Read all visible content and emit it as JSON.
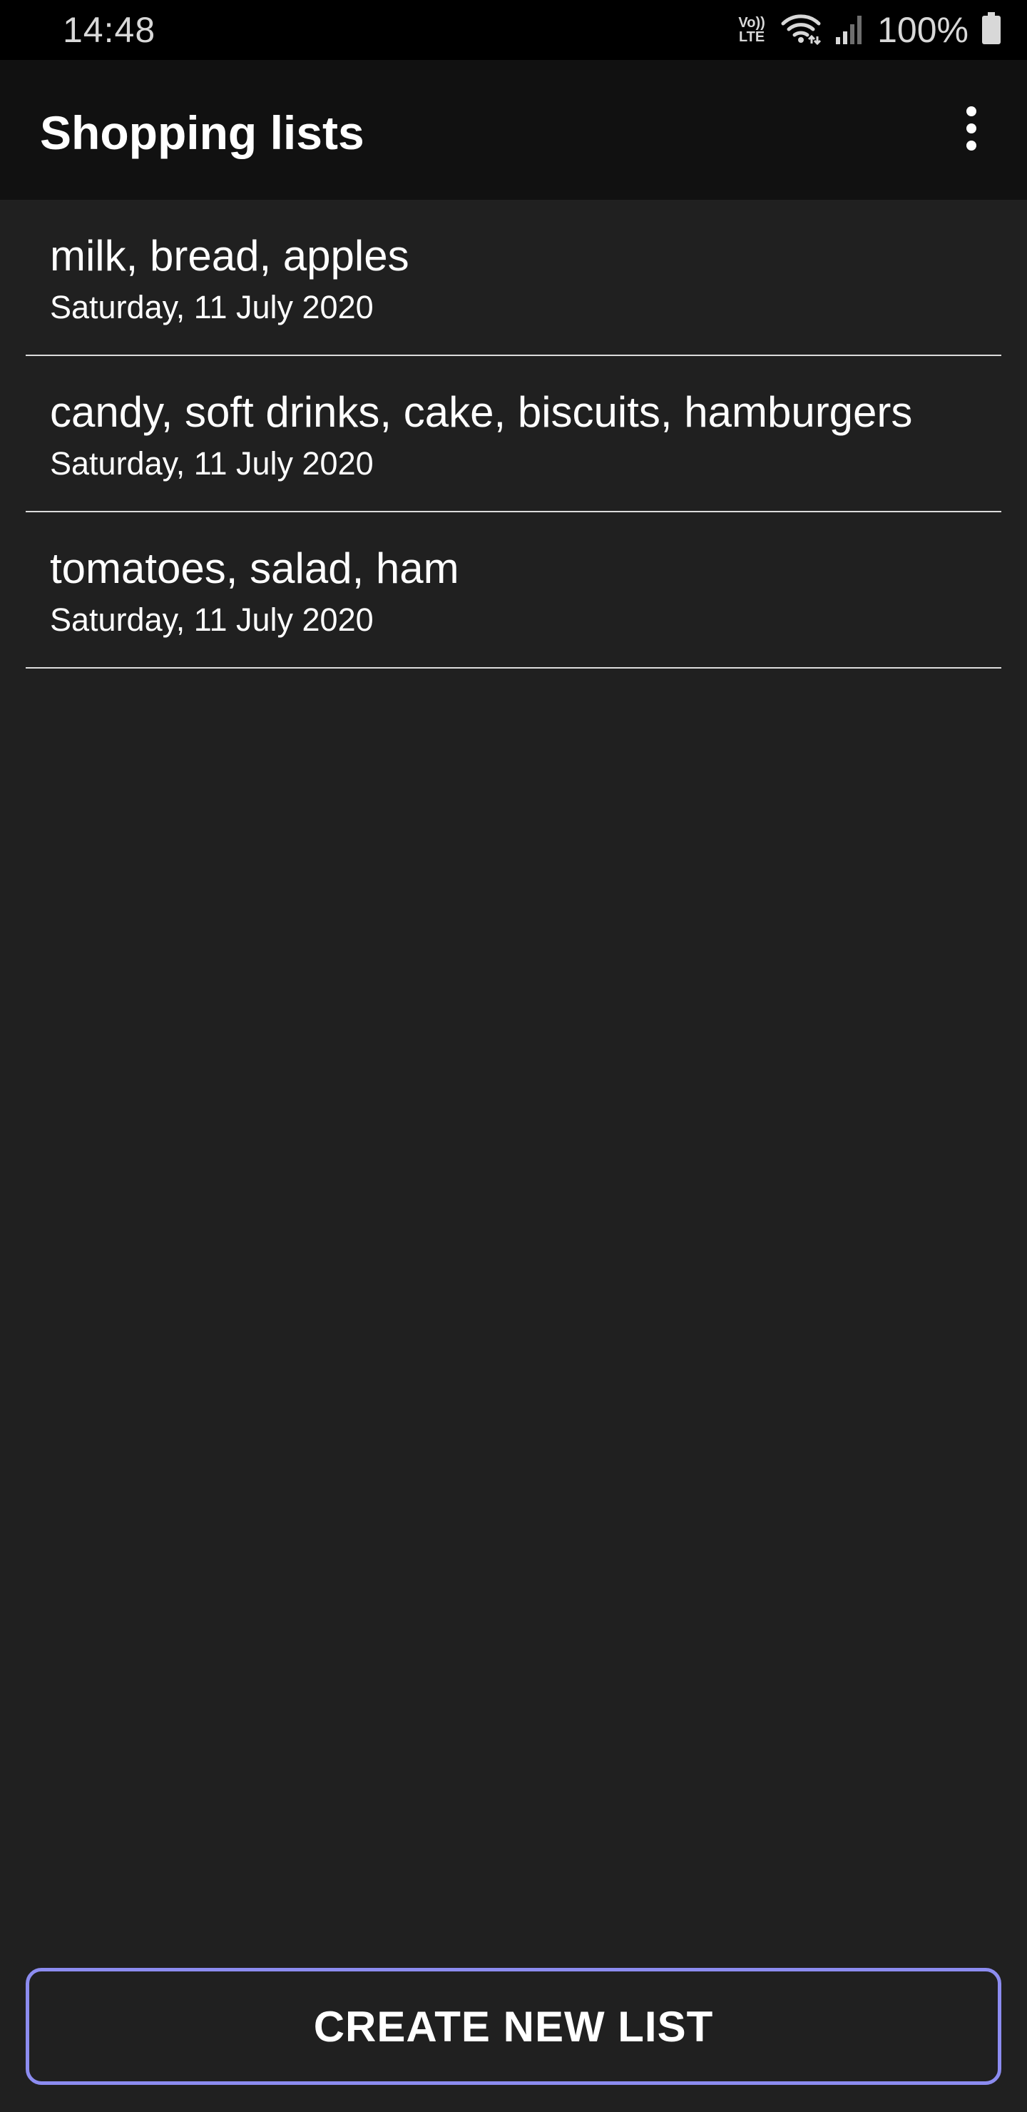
{
  "status_bar": {
    "time": "14:48",
    "volte_top": "Vo))",
    "volte_bottom": "LTE",
    "battery": "100%",
    "icons": [
      "volte-icon",
      "wifi-icon",
      "signal-icon",
      "battery-icon"
    ]
  },
  "app_bar": {
    "title": "Shopping lists",
    "menu_icon": "more-vert-icon"
  },
  "lists": [
    {
      "title": "milk, bread, apples",
      "date": "Saturday, 11 July 2020"
    },
    {
      "title": "candy, soft drinks, cake, biscuits, hamburgers",
      "date": "Saturday, 11 July 2020"
    },
    {
      "title": "tomatoes, salad, ham",
      "date": "Saturday, 11 July 2020"
    }
  ],
  "create_button": {
    "label": "CREATE NEW LIST"
  },
  "colors": {
    "background": "#202020",
    "app_bar": "#111111",
    "status_bar": "#000000",
    "accent_border": "#8c8cf0",
    "divider": "#dcdcdc",
    "text": "#ffffff"
  }
}
